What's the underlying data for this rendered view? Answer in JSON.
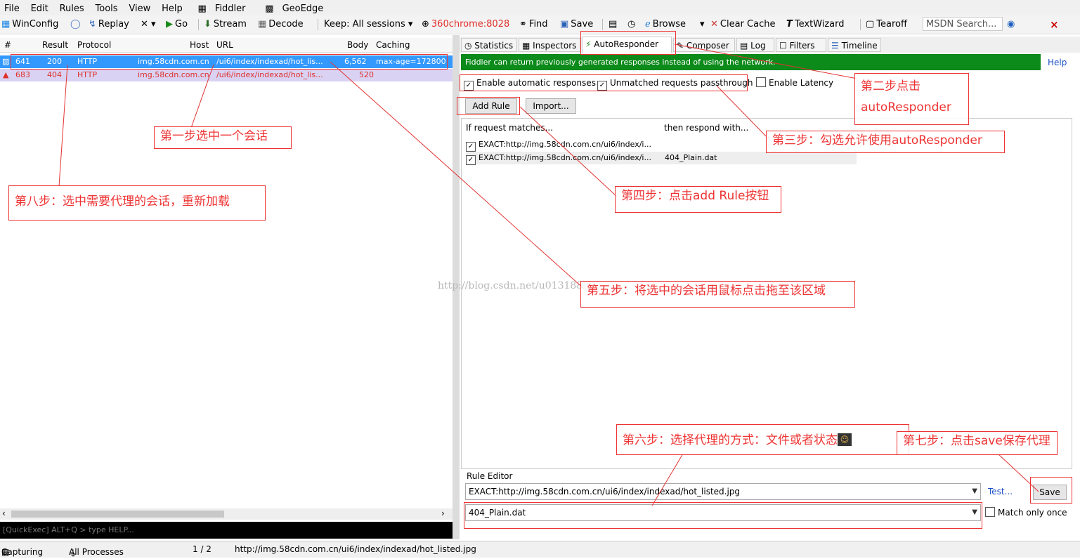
{
  "menu": [
    "File",
    "Edit",
    "Rules",
    "Tools",
    "View",
    "Help",
    "Fiddler",
    "GeoEdge"
  ],
  "toolbar": {
    "winconfig": "WinConfig",
    "replay": "Replay",
    "remove": "✕ ▾",
    "go": "Go",
    "stream": "Stream",
    "decode": "Decode",
    "keep": "Keep: All sessions ▾",
    "process": "360chrome:8028",
    "find": "Find",
    "save": "Save",
    "browse": "Browse",
    "clear_cache": "Clear Cache",
    "textwizard": "TextWizard",
    "tearoff": "Tearoff",
    "msdn_placeholder": "MSDN Search...",
    "close": "×"
  },
  "columns": {
    "num": "#",
    "result": "Result",
    "protocol": "Protocol",
    "host": "Host",
    "url": "URL",
    "body": "Body",
    "caching": "Caching"
  },
  "sessions": [
    {
      "num": "641",
      "result": "200",
      "protocol": "HTTP",
      "host": "img.58cdn.com.cn",
      "url": "/ui6/index/indexad/hot_lis...",
      "body": "6,562",
      "caching": "max-age=172800"
    },
    {
      "num": "683",
      "result": "404",
      "protocol": "HTTP",
      "host": "img.58cdn.com.cn",
      "url": "/ui6/index/indexad/hot_lis...",
      "body": "520",
      "caching": ""
    }
  ],
  "quickexec": "[QuickExec] ALT+Q > type HELP...",
  "status": {
    "capturing": "Capturing",
    "processes": "All Processes",
    "count": "1 / 2",
    "url": "http://img.58cdn.com.cn/ui6/index/indexad/hot_listed.jpg"
  },
  "tabs": {
    "statistics": "Statistics",
    "inspectors": "Inspectors",
    "autoresponder": "AutoResponder",
    "composer": "Composer",
    "log": "Log",
    "filters": "Filters",
    "timeline": "Timeline"
  },
  "banner": "Fiddler can return previously generated responses instead of using the network.",
  "help": "Help",
  "options": {
    "enable_auto": "Enable automatic responses",
    "unmatched": "Unmatched requests passthrough",
    "latency": "Enable Latency"
  },
  "buttons": {
    "add_rule": "Add Rule",
    "import": "Import...",
    "test": "Test...",
    "save": "Save"
  },
  "rules_head": {
    "match": "If request matches...",
    "respond": "then respond with..."
  },
  "rules": [
    {
      "match": "EXACT:http://img.58cdn.com.cn/ui6/index/i...",
      "respond": ""
    },
    {
      "match": "EXACT:http://img.58cdn.com.cn/ui6/index/i...",
      "respond": "404_Plain.dat"
    }
  ],
  "editor": {
    "label": "Rule Editor",
    "match": "EXACT:http://img.58cdn.com.cn/ui6/index/indexad/hot_listed.jpg",
    "respond": "404_Plain.dat",
    "match_once": "Match only once"
  },
  "watermark": "http://blog.csdn.net/u013188008",
  "annotations": {
    "step1": "第一步选中一个会话",
    "step2a": "第二步点击",
    "step2b": "autoResponder",
    "step3": "第三步：勾选允许使用autoResponder",
    "step4": "第四步：点击add Rule按钮",
    "step5": "第五步：将选中的会话用鼠标点击拖至该区域",
    "step6": "第六步：选择代理的方式：文件或者状态",
    "step7": "第七步：点击save保存代理",
    "step8": "第八步：选中需要代理的会话，重新加载"
  },
  "colors": {
    "banner": "#0c8a1a",
    "selected_row": "#3399ff",
    "error_text": "#e0302a",
    "annotation": "#e33333"
  }
}
